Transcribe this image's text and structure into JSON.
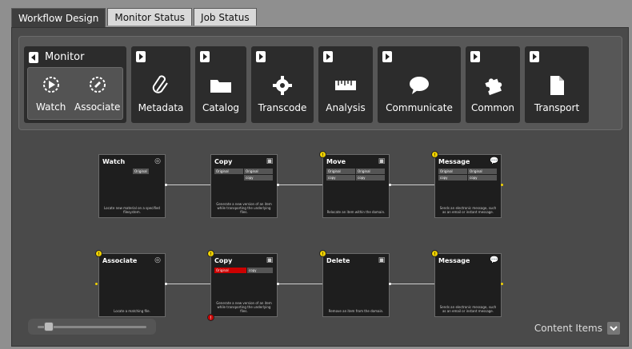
{
  "tabs": [
    "Workflow Design",
    "Monitor Status",
    "Job Status"
  ],
  "toolbar": {
    "monitor_group": {
      "title": "Monitor",
      "items": [
        "Watch",
        "Associate"
      ]
    },
    "groups": [
      {
        "label": "Metadata",
        "icon": "paperclip-icon"
      },
      {
        "label": "Catalog",
        "icon": "folder-icon"
      },
      {
        "label": "Transcode",
        "icon": "gear-icon"
      },
      {
        "label": "Analysis",
        "icon": "ruler-icon"
      },
      {
        "label": "Communicate",
        "icon": "speech-bubble-icon"
      },
      {
        "label": "Common",
        "icon": "puzzle-icon"
      },
      {
        "label": "Transport",
        "icon": "document-icon"
      }
    ]
  },
  "workflow": {
    "row1": [
      {
        "title": "Watch",
        "icon": "watch-icon",
        "ports": [
          "Original"
        ],
        "desc": "Locate new material on a specified filesystem."
      },
      {
        "title": "Copy",
        "icon": "copy-icon",
        "ports": [
          "Original",
          "Original",
          "copy"
        ],
        "desc": "Generate a new version of an item while transporting the underlying files."
      },
      {
        "title": "Move",
        "icon": "move-icon",
        "ports": [
          "Original",
          "Original",
          "copy",
          "copy"
        ],
        "desc": "Relocate an item within the domain."
      },
      {
        "title": "Message",
        "icon": "message-icon",
        "ports": [
          "Original",
          "Original",
          "copy",
          "copy"
        ],
        "desc": "Sends an electronic message, such as an email or instant message."
      }
    ],
    "row2": [
      {
        "title": "Associate",
        "icon": "associate-icon",
        "ports": [],
        "desc": "Locate a matching file."
      },
      {
        "title": "Copy",
        "icon": "copy-icon",
        "ports": [
          "Original",
          "copy"
        ],
        "desc": "Generate a new version of an item while transporting the underlying files."
      },
      {
        "title": "Delete",
        "icon": "delete-icon",
        "ports": [],
        "desc": "Remove an item from the domain."
      },
      {
        "title": "Message",
        "icon": "message-icon",
        "ports": [],
        "desc": "Sends an electronic message, such as an email or instant message."
      }
    ]
  },
  "footer": {
    "content_items_label": "Content Items"
  }
}
